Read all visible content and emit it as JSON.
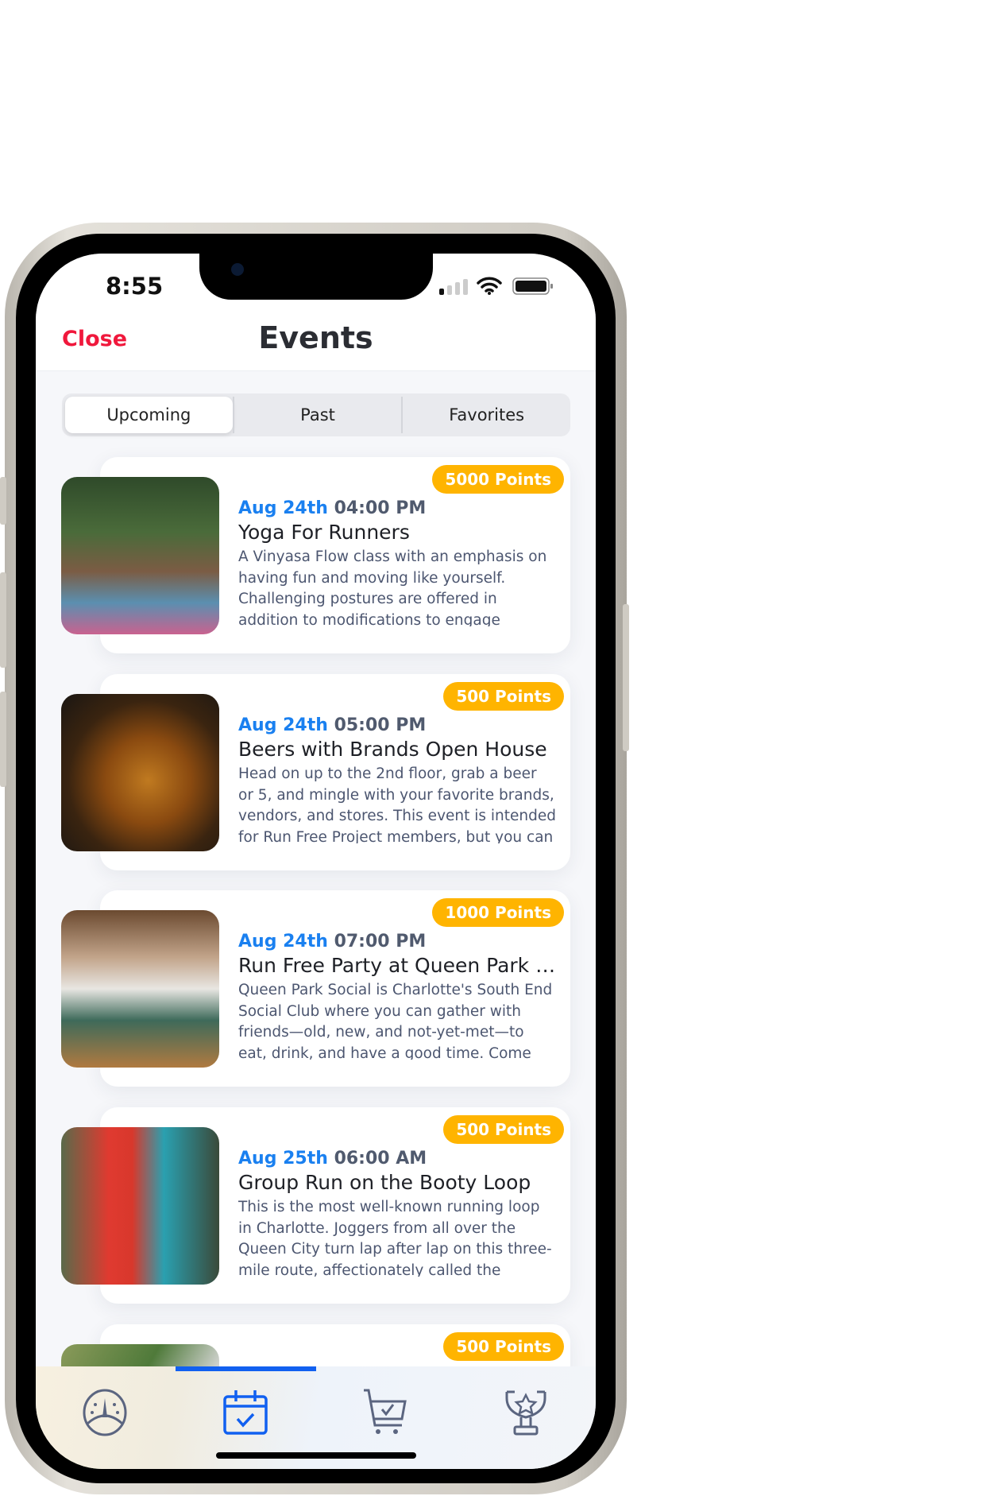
{
  "status": {
    "time": "8:55"
  },
  "header": {
    "close_label": "Close",
    "title": "Events"
  },
  "segments": [
    {
      "label": "Upcoming",
      "selected": true
    },
    {
      "label": "Past",
      "selected": false
    },
    {
      "label": "Favorites",
      "selected": false
    }
  ],
  "colors": {
    "accent": "#1a80f0",
    "close": "#f0183c",
    "badge": "#ffb400",
    "active_tab": "#1160f0"
  },
  "events": [
    {
      "points": "5000 Points",
      "date": "Aug 24th",
      "time": "04:00 PM",
      "title": "Yoga For Runners",
      "description": "A Vinyasa Flow class with an emphasis on having fun and moving like yourself. Challenging postures are offered in addition to modifications to engage"
    },
    {
      "points": "500 Points",
      "date": "Aug 24th",
      "time": "05:00 PM",
      "title": "Beers with Brands Open House",
      "description": "Head on up to the 2nd floor, grab a beer or 5, and mingle with your favorite brands, vendors, and stores. This event is intended for Run Free Project members, but you can"
    },
    {
      "points": "1000 Points",
      "date": "Aug 24th",
      "time": "07:00 PM",
      "title": "Run Free Party at Queen Park Social",
      "description": "Queen Park Social is Charlotte's South End Social Club where you can gather with friends—old, new, and not-yet-met—to eat, drink, and have a good time. Come"
    },
    {
      "points": "500 Points",
      "date": "Aug 25th",
      "time": "06:00 AM",
      "title": "Group Run on the Booty Loop",
      "description": "This is the most well-known running loop in Charlotte. Joggers from all over the Queen City turn lap after lap on this three-mile route, affectionately called the"
    },
    {
      "points": "500 Points"
    }
  ],
  "tabbar": {
    "items": [
      {
        "icon": "dashboard-gauge-icon",
        "active": false
      },
      {
        "icon": "calendar-check-icon",
        "active": true
      },
      {
        "icon": "cart-check-icon",
        "active": false
      },
      {
        "icon": "trophy-icon",
        "active": false
      }
    ]
  }
}
